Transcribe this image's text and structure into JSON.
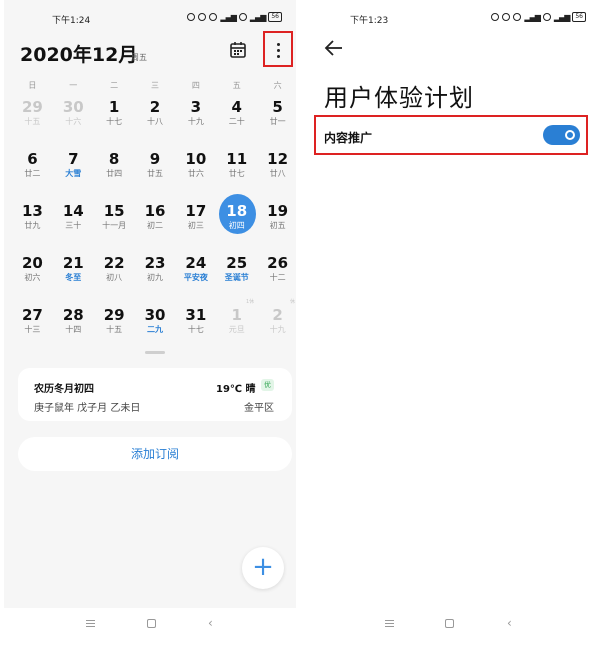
{
  "left": {
    "status_time": "下午1:24",
    "status_extra": "4G",
    "battery": "56",
    "header": {
      "title": "2020年12月",
      "weekday": "周五"
    },
    "weekdays": [
      "日",
      "一",
      "二",
      "三",
      "四",
      "五",
      "六"
    ],
    "weeks": [
      [
        {
          "num": "29",
          "lunar": "十五",
          "dim": true
        },
        {
          "num": "30",
          "lunar": "十六",
          "dim": true
        },
        {
          "num": "1",
          "lunar": "十七"
        },
        {
          "num": "2",
          "lunar": "十八"
        },
        {
          "num": "3",
          "lunar": "十九"
        },
        {
          "num": "4",
          "lunar": "二十"
        },
        {
          "num": "5",
          "lunar": "廿一"
        }
      ],
      [
        {
          "num": "6",
          "lunar": "廿二"
        },
        {
          "num": "7",
          "lunar": "大雪",
          "term": true
        },
        {
          "num": "8",
          "lunar": "廿四"
        },
        {
          "num": "9",
          "lunar": "廿五"
        },
        {
          "num": "10",
          "lunar": "廿六"
        },
        {
          "num": "11",
          "lunar": "廿七"
        },
        {
          "num": "12",
          "lunar": "廿八"
        }
      ],
      [
        {
          "num": "13",
          "lunar": "廿九"
        },
        {
          "num": "14",
          "lunar": "三十"
        },
        {
          "num": "15",
          "lunar": "十一月"
        },
        {
          "num": "16",
          "lunar": "初二"
        },
        {
          "num": "17",
          "lunar": "初三"
        },
        {
          "num": "18",
          "lunar": "初四",
          "today": true
        },
        {
          "num": "19",
          "lunar": "初五"
        }
      ],
      [
        {
          "num": "20",
          "lunar": "初六"
        },
        {
          "num": "21",
          "lunar": "冬至",
          "term": true
        },
        {
          "num": "22",
          "lunar": "初八"
        },
        {
          "num": "23",
          "lunar": "初九"
        },
        {
          "num": "24",
          "lunar": "平安夜",
          "term": true
        },
        {
          "num": "25",
          "lunar": "圣诞节",
          "term": true
        },
        {
          "num": "26",
          "lunar": "十二"
        }
      ],
      [
        {
          "num": "27",
          "lunar": "十三"
        },
        {
          "num": "28",
          "lunar": "十四"
        },
        {
          "num": "29",
          "lunar": "十五"
        },
        {
          "num": "30",
          "lunar": "二九",
          "term": true
        },
        {
          "num": "31",
          "lunar": "十七"
        },
        {
          "num": "1",
          "lunar": "元旦",
          "dim": true,
          "ribbon": "1休"
        },
        {
          "num": "2",
          "lunar": "十九",
          "dim": true,
          "ribbon": "休"
        }
      ]
    ],
    "info_card": {
      "lunar_date": "农历冬月初四",
      "weather": "19℃ 晴",
      "aqi": "优",
      "ganzhi": "庚子鼠年 戊子月 乙未日",
      "location": "金平区"
    },
    "subscribe_label": "添加订阅",
    "fab_label": "+"
  },
  "right": {
    "status_time": "下午1:23",
    "status_extra": "4G",
    "battery": "56",
    "title": "用户体验计划",
    "setting_label": "内容推广",
    "toggle_on": true
  },
  "colors": {
    "accent": "#3d8fe3",
    "highlight_border": "#d22222",
    "lunar_term": "#2a7fd4",
    "aqi_good": "#2ea44f"
  }
}
